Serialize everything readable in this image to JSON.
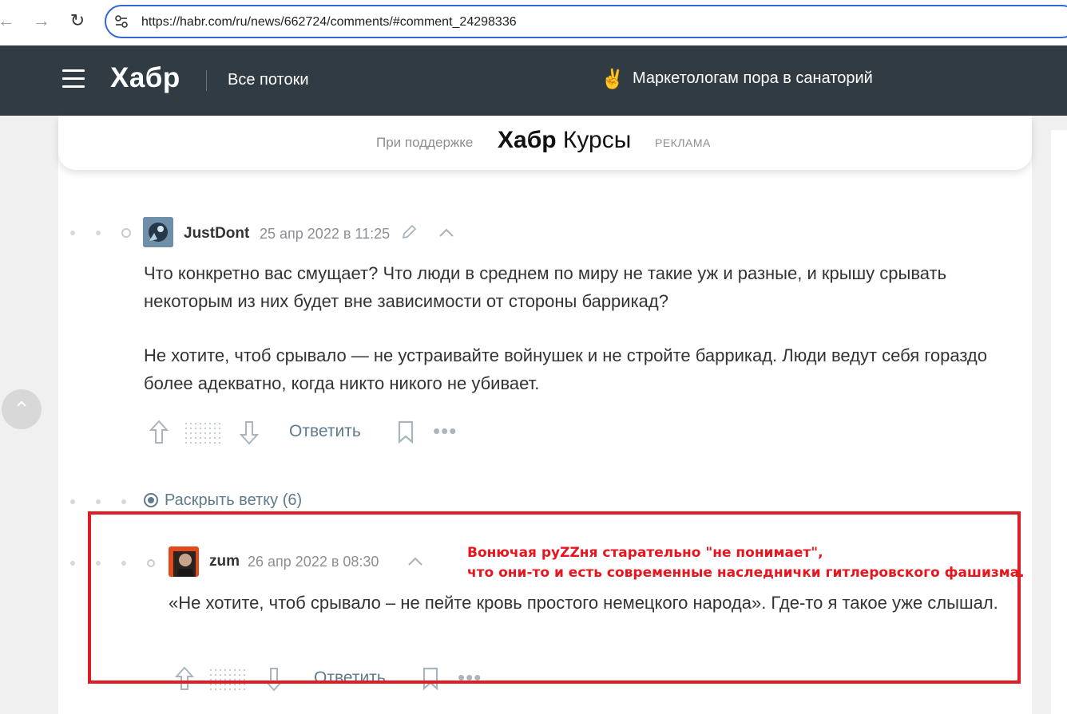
{
  "browser": {
    "url": "https://habr.com/ru/news/662724/comments/#comment_24298336"
  },
  "header": {
    "logo": "Хабр",
    "nav_link": "Все потоки",
    "promo_emoji": "✌️",
    "promo_text": "Маркетологам пора в санаторий"
  },
  "sponsor": {
    "support_label": "При поддержке",
    "brand_bold": "Хабр",
    "brand_regular": "Курсы",
    "ad_label": "РЕКЛАМА"
  },
  "comments": [
    {
      "username": "JustDont",
      "datetime": "25 апр 2022 в 11:25",
      "paragraphs": [
        "Что конкретно вас смущает? Что люди в среднем по миру не такие уж и разные, и крышу срывать некоторым из них будет вне зависимости от стороны баррикад?",
        "Не хотите, чтоб срывало — не устраивайте войнушек и не стройте баррикад. Люди ведут себя гораздо более адекватно, когда никто никого не убивает."
      ],
      "reply_label": "Ответить"
    },
    {
      "username": "zum",
      "datetime": "26 апр 2022 в 08:30",
      "paragraphs": [
        "«Не хотите, чтоб срывало – не пейте кровь простого немецкого народа». Где-то я такое уже слышал."
      ],
      "reply_label": "Ответить"
    }
  ],
  "expand_thread": "Раскрыть ветку (6)",
  "annotation": {
    "line1": "Вонючая руZZня старательно \"не понимает\",",
    "line2": "что они-то и есть современные наследнички гитлеровского фашизма.",
    "color": "#e8141e"
  },
  "colors": {
    "header_bg": "#303b44",
    "link": "#5e7a8c",
    "highlight": "#e01c24"
  }
}
